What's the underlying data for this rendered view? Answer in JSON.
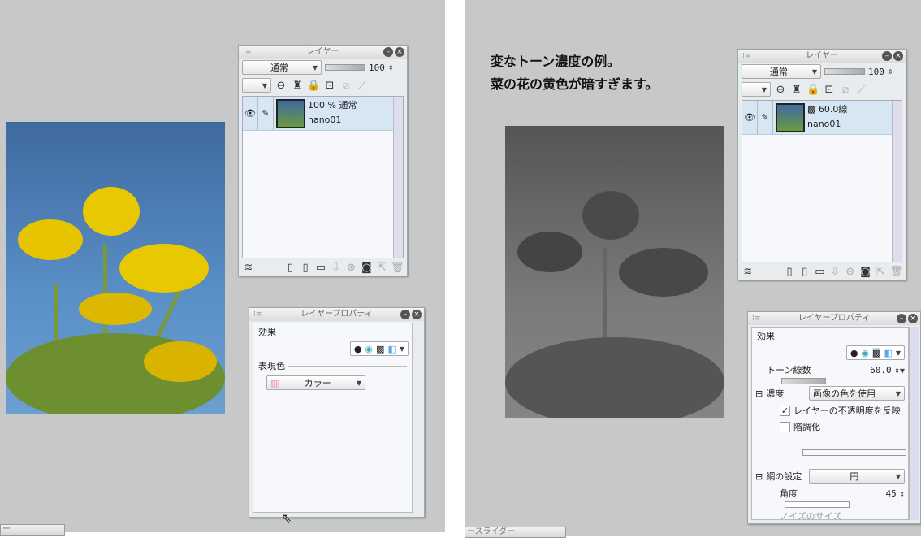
{
  "left": {
    "layer_panel": {
      "title": "レイヤー",
      "blend_mode": "通常",
      "opacity": "100",
      "layer": {
        "name_line1": "100 % 通常",
        "name_line2": "nano01"
      }
    },
    "props_panel": {
      "title": "レイヤープロパティ",
      "effect_label": "効果",
      "expression_label": "表現色",
      "expression_value": "カラー"
    },
    "bottom_panel_title": "ー"
  },
  "right": {
    "note_line1": "変なトーン濃度の例。",
    "note_line2": "菜の花の黄色が暗すぎます。",
    "layer_panel": {
      "title": "レイヤー",
      "blend_mode": "通常",
      "opacity": "100",
      "layer": {
        "name_line1": "60.0線",
        "name_line2": "nano01"
      }
    },
    "props_panel": {
      "title": "レイヤープロパティ",
      "effect_label": "効果",
      "tone_lines_label": "トーン線数",
      "tone_lines_value": "60.0",
      "density_label": "濃度",
      "density_value": "画像の色を使用",
      "reflect_opacity_label": "レイヤーの不透明度を反映",
      "reflect_opacity_checked": true,
      "posterize_label": "階調化",
      "posterize_checked": false,
      "dot_settings_label": "網の設定",
      "dot_shape": "円",
      "angle_label": "角度",
      "angle_value": "45",
      "noise_size_label": "ノイズのサイズ"
    },
    "bottom_panel_title": "ースライダー"
  }
}
